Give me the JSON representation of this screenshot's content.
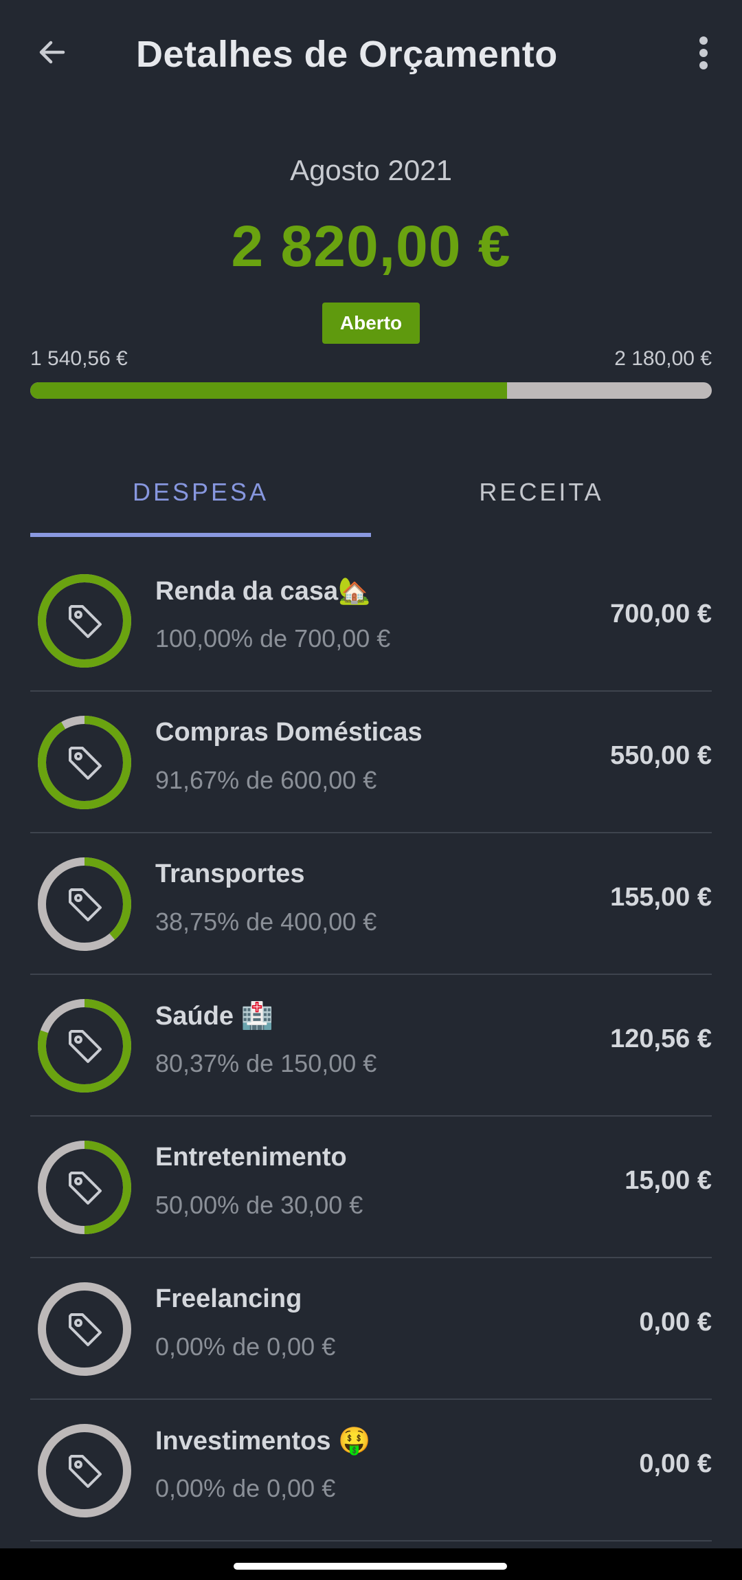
{
  "header": {
    "title": "Detalhes de Orçamento",
    "back_icon": "arrow-left-icon",
    "menu_icon": "more-vertical-icon"
  },
  "summary": {
    "month": "Agosto 2021",
    "total": "2 820,00 €",
    "status": "Aberto",
    "progress_min": "1 540,56 €",
    "progress_max": "2 180,00 €",
    "progress_fraction": 0.7
  },
  "tabs": [
    {
      "label": "DESPESA",
      "active": true
    },
    {
      "label": "RECEITA",
      "active": false
    }
  ],
  "colors": {
    "background": "#232831",
    "accent_green": "#6aa310",
    "ring_track": "#bdb9b9",
    "tab_active": "#8797df"
  },
  "categories": [
    {
      "name": "Renda da casa🏡",
      "detail": "100,00% de 700,00 €",
      "amount": "700,00 €",
      "progress": 1.0,
      "icon": "tag-icon"
    },
    {
      "name": "Compras Domésticas",
      "detail": "91,67% de 600,00 €",
      "amount": "550,00 €",
      "progress": 0.9167,
      "icon": "tag-icon"
    },
    {
      "name": "Transportes",
      "detail": "38,75% de 400,00 €",
      "amount": "155,00 €",
      "progress": 0.3875,
      "icon": "tag-icon"
    },
    {
      "name": "Saúde 🏥",
      "detail": "80,37% de 150,00 €",
      "amount": "120,56 €",
      "progress": 0.8037,
      "icon": "tag-icon"
    },
    {
      "name": "Entretenimento",
      "detail": "50,00% de 30,00 €",
      "amount": "15,00 €",
      "progress": 0.5,
      "icon": "tag-icon"
    },
    {
      "name": "Freelancing",
      "detail": "0,00% de 0,00 €",
      "amount": "0,00 €",
      "progress": 0.0,
      "icon": "tag-icon"
    },
    {
      "name": "Investimentos 🤑",
      "detail": "0,00% de 0,00 €",
      "amount": "0,00 €",
      "progress": 0.0,
      "icon": "tag-icon"
    }
  ]
}
